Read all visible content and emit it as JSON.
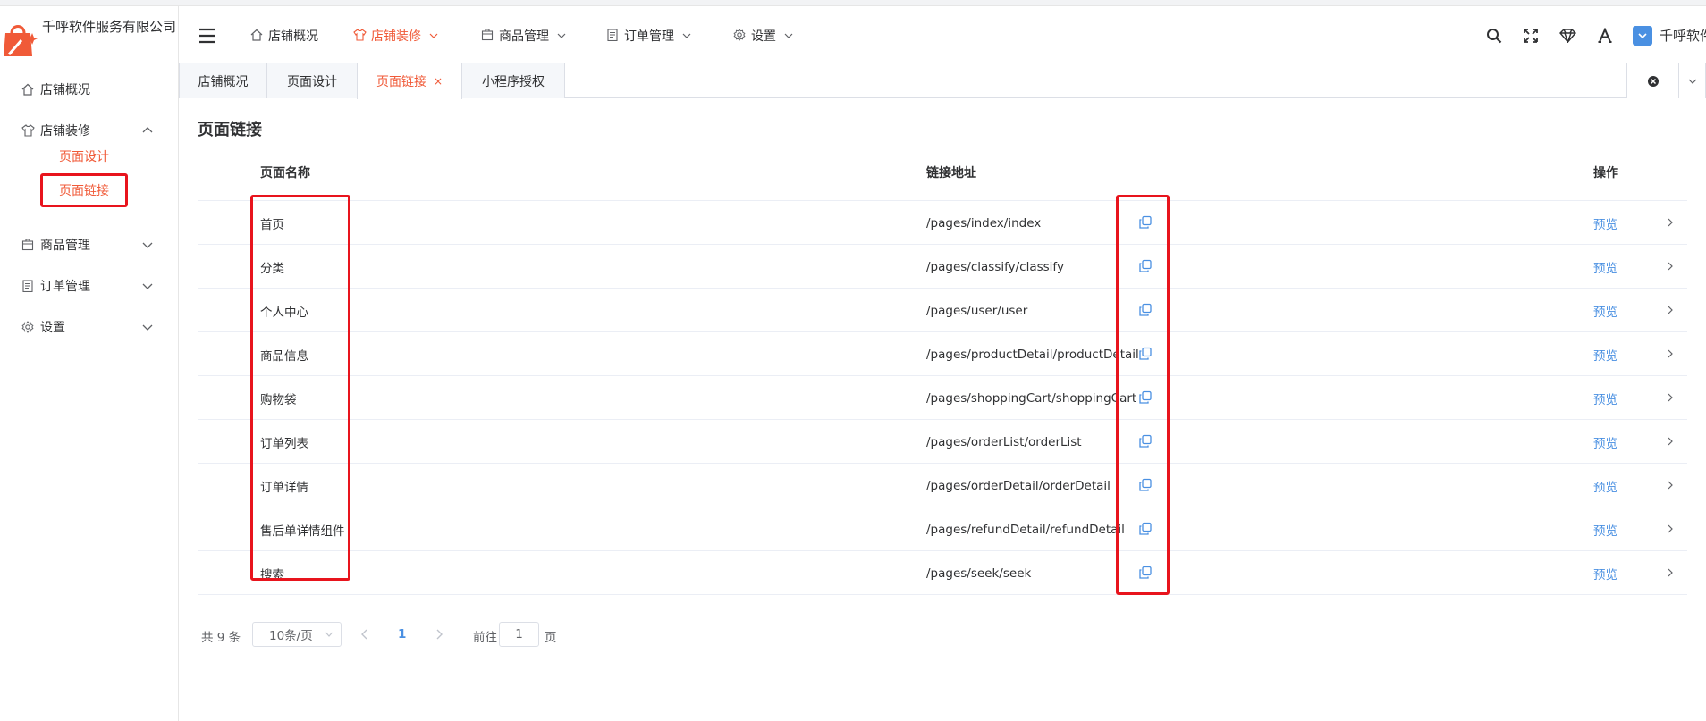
{
  "brand": {
    "name": "千呼软件服务有限公司",
    "color": "#f05a38"
  },
  "sidebar": {
    "items": [
      {
        "label": "店铺概况",
        "icon": "home-icon"
      },
      {
        "label": "店铺装修",
        "icon": "shirt-icon",
        "expanded": true,
        "children": [
          {
            "label": "页面设计"
          },
          {
            "label": "页面链接",
            "active": true
          }
        ]
      },
      {
        "label": "商品管理",
        "icon": "box-icon"
      },
      {
        "label": "订单管理",
        "icon": "list-icon"
      },
      {
        "label": "设置",
        "icon": "gear-icon"
      }
    ]
  },
  "header": {
    "nav": [
      {
        "label": "店铺概况",
        "icon": "home-icon"
      },
      {
        "label": "店铺装修",
        "icon": "shirt-icon",
        "active": true
      },
      {
        "label": "商品管理",
        "icon": "box-icon"
      },
      {
        "label": "订单管理",
        "icon": "list-icon"
      },
      {
        "label": "设置",
        "icon": "gear-icon"
      }
    ],
    "user": "千呼软件"
  },
  "tabs": [
    {
      "label": "店铺概况"
    },
    {
      "label": "页面设计"
    },
    {
      "label": "页面链接",
      "active": true,
      "closable": "×"
    },
    {
      "label": "小程序授权"
    }
  ],
  "main": {
    "title": "页面链接",
    "columns": {
      "name": "页面名称",
      "url": "链接地址",
      "action": "操作"
    },
    "preview_label": "预览",
    "rows": [
      {
        "name": "首页",
        "url": "/pages/index/index"
      },
      {
        "name": "分类",
        "url": "/pages/classify/classify"
      },
      {
        "name": "个人中心",
        "url": "/pages/user/user"
      },
      {
        "name": "商品信息",
        "url": "/pages/productDetail/productDetail"
      },
      {
        "name": "购物袋",
        "url": "/pages/shoppingCart/shoppingCart"
      },
      {
        "name": "订单列表",
        "url": "/pages/orderList/orderList"
      },
      {
        "name": "订单详情",
        "url": "/pages/orderDetail/orderDetail"
      },
      {
        "name": "售后单详情组件",
        "url": "/pages/refundDetail/refundDetail"
      },
      {
        "name": "搜索",
        "url": "/pages/seek/seek"
      }
    ]
  },
  "pagination": {
    "total": "共 9 条",
    "page_size": "10条/页",
    "current": "1",
    "goto_label": "前往",
    "goto_value": "1",
    "page_unit": "页"
  },
  "colors": {
    "accent": "#f05a38",
    "link": "#4a90e2",
    "highlight": "#e8141d"
  }
}
